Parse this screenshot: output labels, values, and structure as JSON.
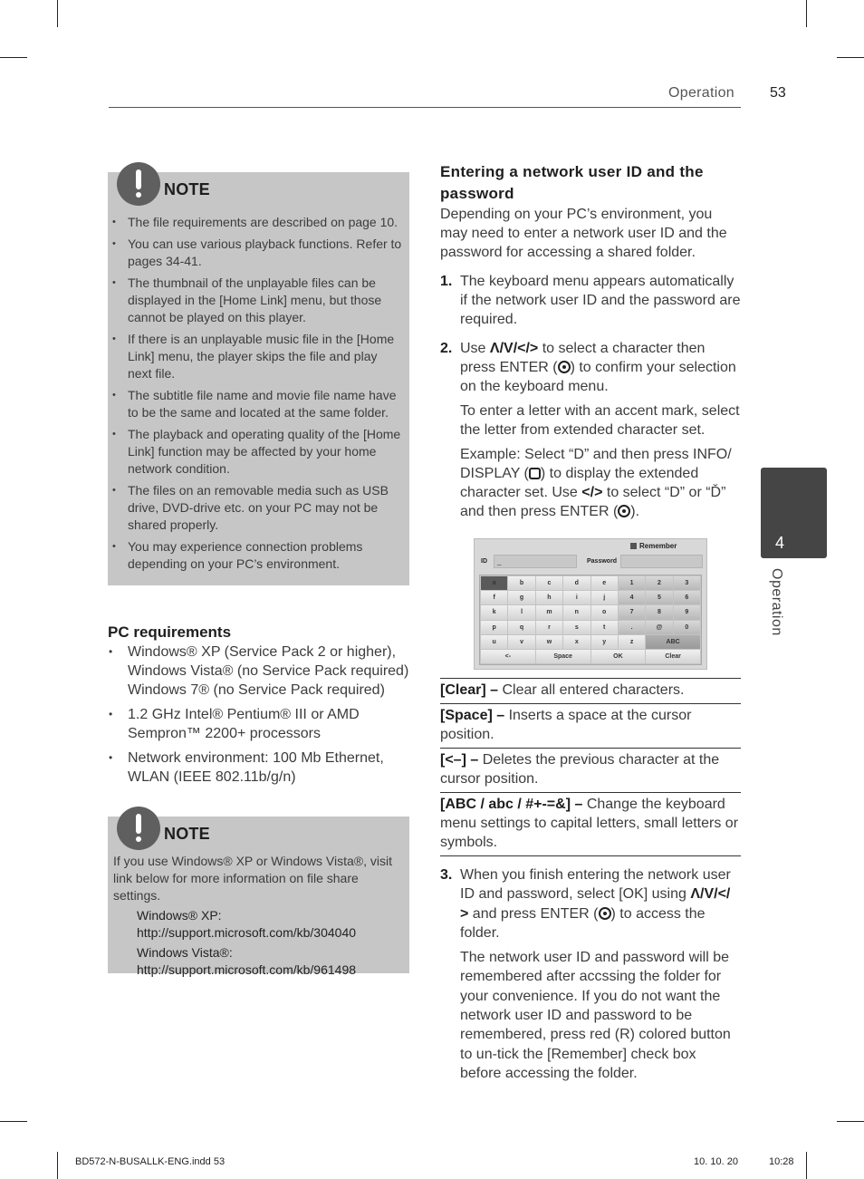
{
  "header": {
    "section": "Operation",
    "page_number": "53"
  },
  "note1": {
    "title": "NOTE",
    "icon": "exclamation-icon",
    "items": [
      "The file requirements are described on page 10.",
      "You can use various playback functions. Refer to pages 34-41.",
      "The thumbnail of the unplayable files can be displayed in the [Home Link] menu, but those cannot be played on this player.",
      "If there is an unplayable music file in the [Home Link] menu, the player skips the file and play next file.",
      "The subtitle file name and movie file name have to be the same and located at the same folder.",
      "The playback and operating quality of the [Home Link] function may be affected by your home network condition.",
      "The files on an removable media such as USB drive, DVD-drive etc. on your PC may not be shared properly.",
      "You may experience connection problems depending on your PC’s environment."
    ]
  },
  "pc_requirements": {
    "title": "PC requirements",
    "items": [
      "Windows® XP (Service Pack 2 or higher), Windows Vista® (no Service Pack required) Windows 7® (no Service Pack required)",
      "1.2 GHz Intel® Pentium® III or AMD Sempron™ 2200+ processors",
      "Network environment: 100 Mb Ethernet, WLAN (IEEE 802.11b/g/n)"
    ]
  },
  "note2": {
    "title": "NOTE",
    "icon": "exclamation-icon",
    "intro": "If you use Windows® XP or Windows Vista®, visit link below for more information on file share settings.",
    "links": [
      {
        "label": "Windows® XP:",
        "url": "http://support.microsoft.com/kb/304040"
      },
      {
        "label": "Windows Vista®:",
        "url": "http://support.microsoft.com/kb/961498"
      }
    ]
  },
  "section": {
    "title": "Entering a network user ID and the password",
    "intro": "Depending on your PC’s environment, you may need to enter a network user ID and the password for accessing a shared folder.",
    "step1": {
      "num": "1.",
      "text": "The keyboard menu appears automatically if the network user ID and the password are required."
    },
    "step2": {
      "num": "2.",
      "use": "Use",
      "arrows": "Λ/V/</>",
      "text_a": " to select a character then press ENTER (",
      "text_b": ") to confirm your selection on the keyboard menu.",
      "para2": "To enter a letter with an accent mark, select the letter from extended character set.",
      "para3_a": "Example: Select “D” and then press INFO/ DISPLAY (",
      "para3_b": ") to display the extended character set. Use ",
      "para3_arrows": "</>",
      "para3_c": " to select “D” or “Ď” and then press ENTER (",
      "para3_d": ")."
    },
    "step3": {
      "num": "3.",
      "text_a": "When you finish entering the network user ID and password, select [OK] using ",
      "arrows": "Λ/V/</ >",
      "text_b": " and press ENTER (",
      "text_c": ") to access the folder.",
      "para2": "The network user ID and password will be remembered after accssing the folder for your convenience. If you do not want the network user ID and password to be remembered, press red (R) colored button to un-tick the [Remember] check box before accessing the folder."
    }
  },
  "keyboard_screen": {
    "remember_label": "Remember",
    "remember_checked": true,
    "id_label": "ID",
    "id_value": "_",
    "password_label": "Password",
    "password_value": "",
    "rows": [
      [
        "a",
        "b",
        "c",
        "d",
        "e",
        "1",
        "2",
        "3"
      ],
      [
        "f",
        "g",
        "h",
        "i",
        "j",
        "4",
        "5",
        "6"
      ],
      [
        "k",
        "l",
        "m",
        "n",
        "o",
        "7",
        "8",
        "9"
      ],
      [
        "p",
        "q",
        "r",
        "s",
        "t",
        ".",
        "@",
        "0"
      ],
      [
        "u",
        "v",
        "w",
        "x",
        "y",
        "z",
        "ABC"
      ]
    ],
    "bottom_row": [
      "<-",
      "Space",
      "OK",
      "Clear"
    ],
    "selected_key": "a"
  },
  "definitions": [
    {
      "term": "[Clear] –",
      "desc": " Clear all entered characters."
    },
    {
      "term": "[Space] –",
      "desc": " Inserts a space at the cursor position."
    },
    {
      "term": "[<–] –",
      "desc": " Deletes the previous character at the cursor position."
    },
    {
      "term": "[ABC / abc / #+-=&] –",
      "desc": " Change the keyboard menu settings to capital letters, small letters or symbols."
    }
  ],
  "side_tab": {
    "chapter_number": "4",
    "chapter_label": "Operation"
  },
  "slug": {
    "file": "BD572-N-BUSALLK-ENG.indd   53",
    "date": "10. 10. 20",
    "time": "10:28"
  }
}
